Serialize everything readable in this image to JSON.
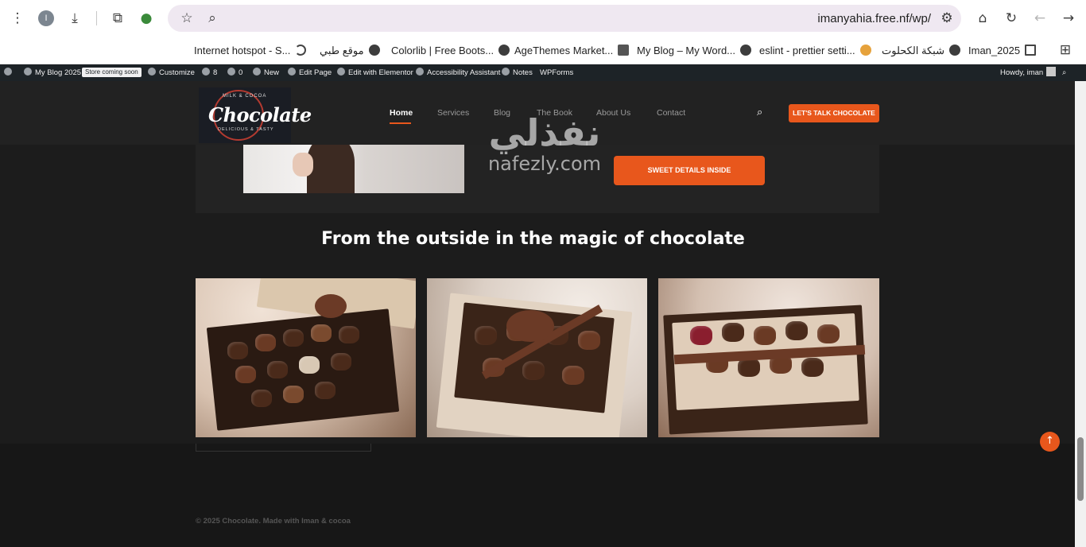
{
  "browser": {
    "url": "imanyahia.free.nf/wp/",
    "profile_initial": "I",
    "bookmarks": [
      {
        "label": "Internet hotspot - S...",
        "icon": "moon-icon"
      },
      {
        "label": "موقع طبي",
        "icon": "globe-icon"
      },
      {
        "label": "Colorlib | Free Boots...",
        "icon": "globe-icon"
      },
      {
        "label": "AgeThemes Market...",
        "icon": "agethemes-icon"
      },
      {
        "label": "My Blog – My Word...",
        "icon": "globe-icon"
      },
      {
        "label": "eslint - prettier setti...",
        "icon": "stackoverflow-icon"
      },
      {
        "label": "شبكة الكحلوت",
        "icon": "globe-icon"
      },
      {
        "label": "Iman_2025",
        "icon": "folder-icon"
      }
    ]
  },
  "adminbar": {
    "site_name": "My Blog 2025",
    "badge": "Store coming soon",
    "customize": "Customize",
    "updates": "8",
    "comments": "0",
    "new": "New",
    "edit_page": "Edit Page",
    "elementor": "Edit with Elementor",
    "accessibility": "Accessibility Assistant",
    "notes": "Notes",
    "wpforms": "WPForms",
    "howdy": "Howdy, iman"
  },
  "site": {
    "logo": {
      "word": "Chocolate",
      "top": "MILK & COCOA",
      "bottom": "DELICIOUS & TASTY"
    },
    "nav": [
      "Home",
      "Services",
      "Blog",
      "The Book",
      "About Us",
      "Contact"
    ],
    "cta_top": "LET'S TALK CHOCOLATE",
    "cta_sweet": "SWEET DETAILS INSIDE",
    "section_title": "From the outside in the magic of chocolate",
    "copyright": "© 2025 Chocolate. Made with Iman & cocoa"
  },
  "watermark": {
    "arabic": "نفذلي",
    "latin": "nafezly.com"
  },
  "colors": {
    "accent": "#e8571c",
    "admin_bar": "#1d2327",
    "page_bg": "#1c1c1c"
  }
}
